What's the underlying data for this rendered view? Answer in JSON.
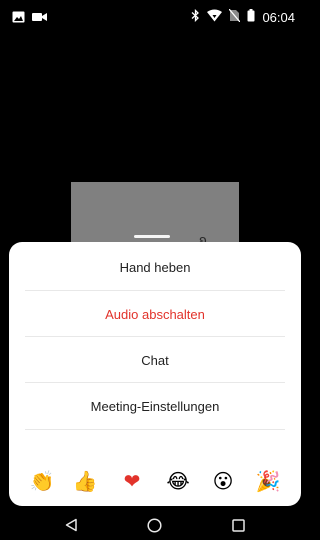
{
  "status_bar": {
    "time": "06:04",
    "left_icons": [
      "image-icon",
      "video-camera-icon"
    ],
    "right_icons": [
      "bluetooth-icon",
      "wifi-icon",
      "no-sim-icon",
      "battery-icon"
    ]
  },
  "video": {
    "tile_logo_text": "wurzelzahn"
  },
  "menu": {
    "items": [
      {
        "label": "Hand heben",
        "color": "#222222"
      },
      {
        "label": "Audio abschalten",
        "color": "#e2332b"
      },
      {
        "label": "Chat",
        "color": "#222222"
      },
      {
        "label": "Meeting-Einstellungen",
        "color": "#222222"
      }
    ]
  },
  "reactions": [
    {
      "name": "clapping-hands-icon",
      "glyph": "👏"
    },
    {
      "name": "thumbs-up-icon",
      "glyph": "👍"
    },
    {
      "name": "heart-icon",
      "glyph": "❤"
    },
    {
      "name": "tears-of-joy-icon",
      "glyph": "😂"
    },
    {
      "name": "surprised-face-icon",
      "glyph": "😮"
    },
    {
      "name": "party-popper-icon",
      "glyph": "🎉"
    }
  ],
  "nav_bar": {
    "buttons": [
      "back-icon",
      "home-icon",
      "recents-icon"
    ]
  }
}
